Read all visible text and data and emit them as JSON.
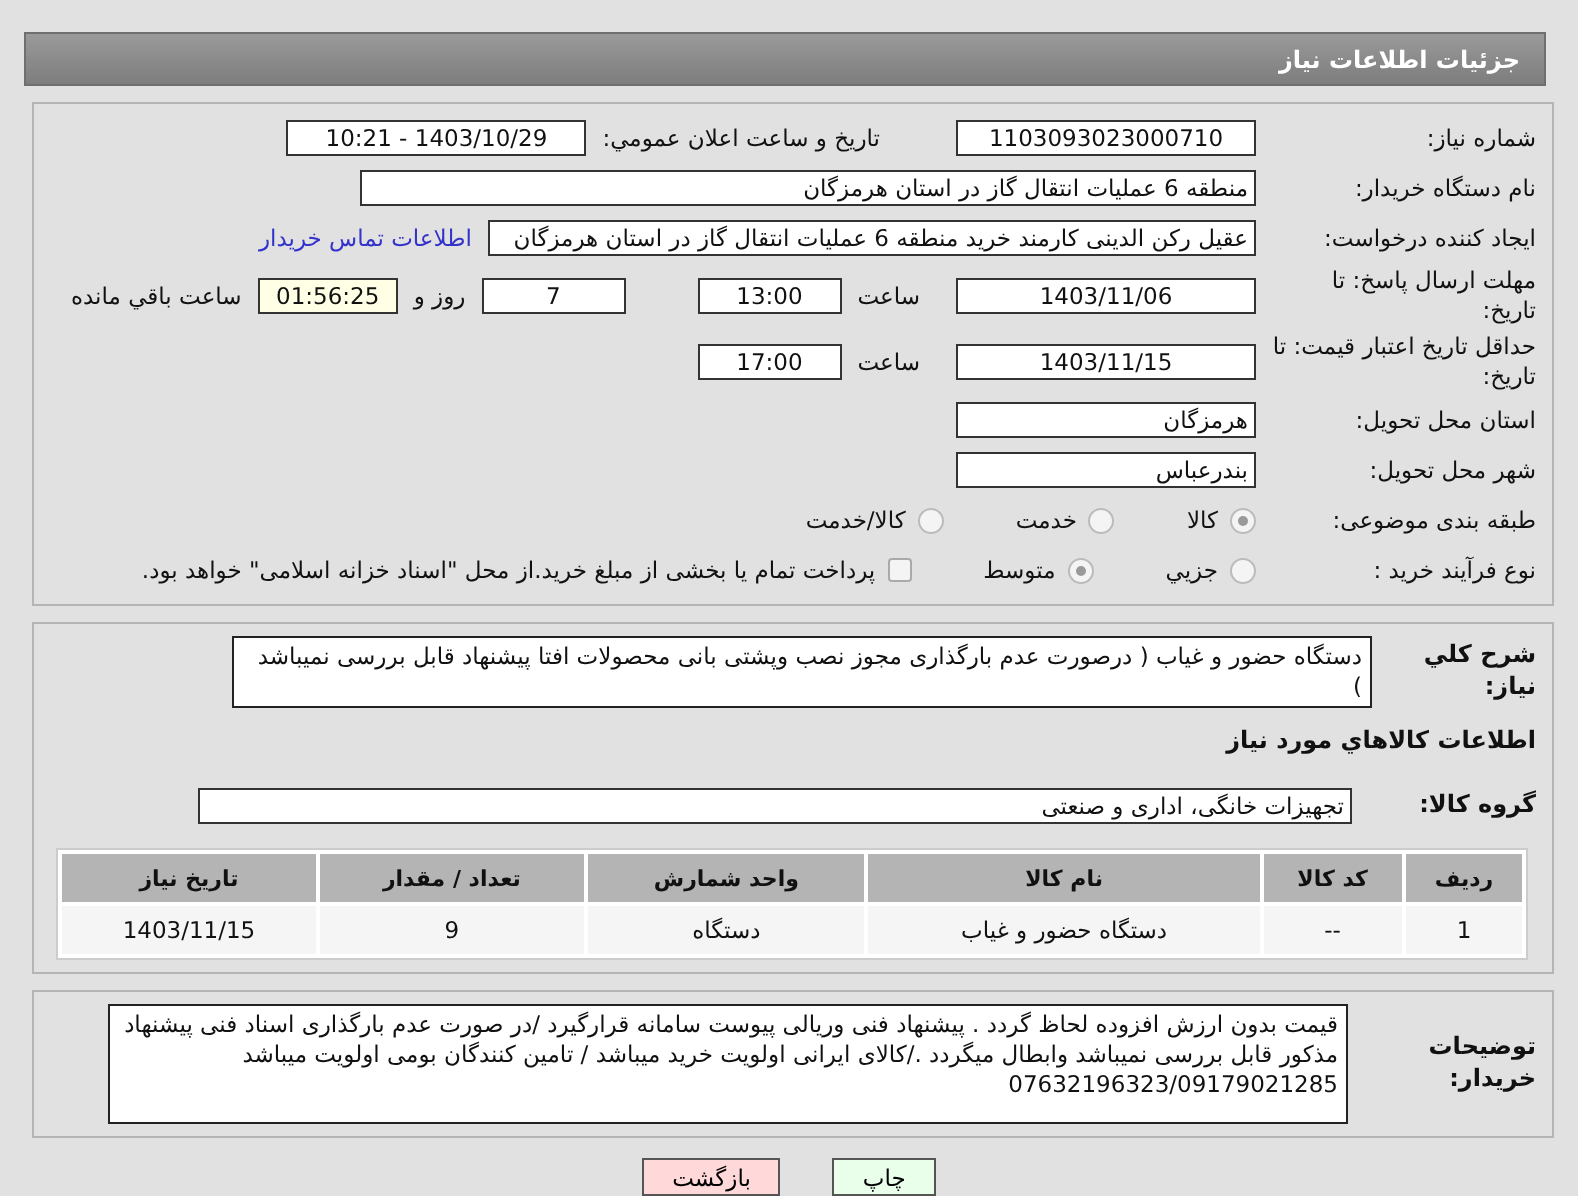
{
  "header": {
    "title": "جزئیات اطلاعات نیاز"
  },
  "need_number": {
    "label": "شماره نیاز:",
    "value": "1103093023000710"
  },
  "announce": {
    "label": "تاریخ و ساعت اعلان عمومي:",
    "value": "1403/10/29 - 10:21"
  },
  "buyer": {
    "label": "نام دستگاه خریدار:",
    "value": "منطقه 6 عملیات انتقال گاز در استان هرمزگان"
  },
  "creator": {
    "label": "ایجاد کننده درخواست:",
    "value": "عقیل رکن الدینی کارمند خرید منطقه 6 عملیات انتقال گاز در استان هرمزگان",
    "link": "اطلاعات تماس خریدار"
  },
  "deadline": {
    "label": "مهلت ارسال پاسخ: تا تاریخ:",
    "date": "1403/11/06",
    "time_label": "ساعت",
    "time": "13:00",
    "days": "7",
    "days_label": "روز و",
    "remaining": "01:56:25",
    "remaining_label": "ساعت باقي مانده"
  },
  "validity": {
    "label": "حداقل تاریخ اعتبار قیمت: تا تاریخ:",
    "date": "1403/11/15",
    "time_label": "ساعت",
    "time": "17:00"
  },
  "province": {
    "label": "استان محل تحویل:",
    "value": "هرمزگان"
  },
  "city": {
    "label": "شهر محل تحویل:",
    "value": "بندرعباس"
  },
  "category": {
    "label": "طبقه بندی موضوعی:",
    "options": [
      {
        "label": "کالا",
        "selected": true
      },
      {
        "label": "خدمت",
        "selected": false
      },
      {
        "label": "کالا/خدمت",
        "selected": false
      }
    ]
  },
  "process": {
    "label": "نوع فرآیند خرید :",
    "options": [
      {
        "label": "جزیي",
        "selected": false
      },
      {
        "label": "متوسط",
        "selected": true
      }
    ],
    "treasury": {
      "label": "پرداخت تمام یا بخشی از مبلغ خرید.از محل \"اسناد خزانه اسلامی\" خواهد بود.",
      "checked": false
    }
  },
  "summary": {
    "label": "شرح کلي نیاز:",
    "value": "دستگاه حضور و غیاب ( درصورت عدم بارگذاری مجوز نصب وپشتی بانی محصولات افتا پیشنهاد قابل بررسی نمیباشد )"
  },
  "goods_title": "اطلاعات کالاهاي مورد نیاز",
  "goods_group": {
    "label": "گروه کالا:",
    "value": "تجهیزات خانگی، اداری و صنعتی"
  },
  "table": {
    "columns": [
      "ردیف",
      "کد کالا",
      "نام کالا",
      "واحد شمارش",
      "تعداد / مقدار",
      "تاریخ نیاز"
    ],
    "rows": [
      [
        "1",
        "--",
        "دستگاه حضور و غیاب",
        "دستگاه",
        "9",
        "1403/11/15"
      ]
    ]
  },
  "notes": {
    "label": "توضیحات خریدار:",
    "value": "قیمت بدون ارزش افزوده لحاظ گردد . پیشنهاد فنی وریالی پیوست سامانه قرارگیرد /در صورت عدم بارگذاری اسناد فنی پیشنهاد مذکور قابل بررسی نمیباشد وابطال میگردد ./کالای ایرانی اولویت خرید میباشد / تامین کنندگان بومی اولویت میباشد 07632196323/09179021285"
  },
  "buttons": [
    {
      "label": "چاپ",
      "kind": "print"
    },
    {
      "label": "بازگشت",
      "kind": "back"
    }
  ]
}
